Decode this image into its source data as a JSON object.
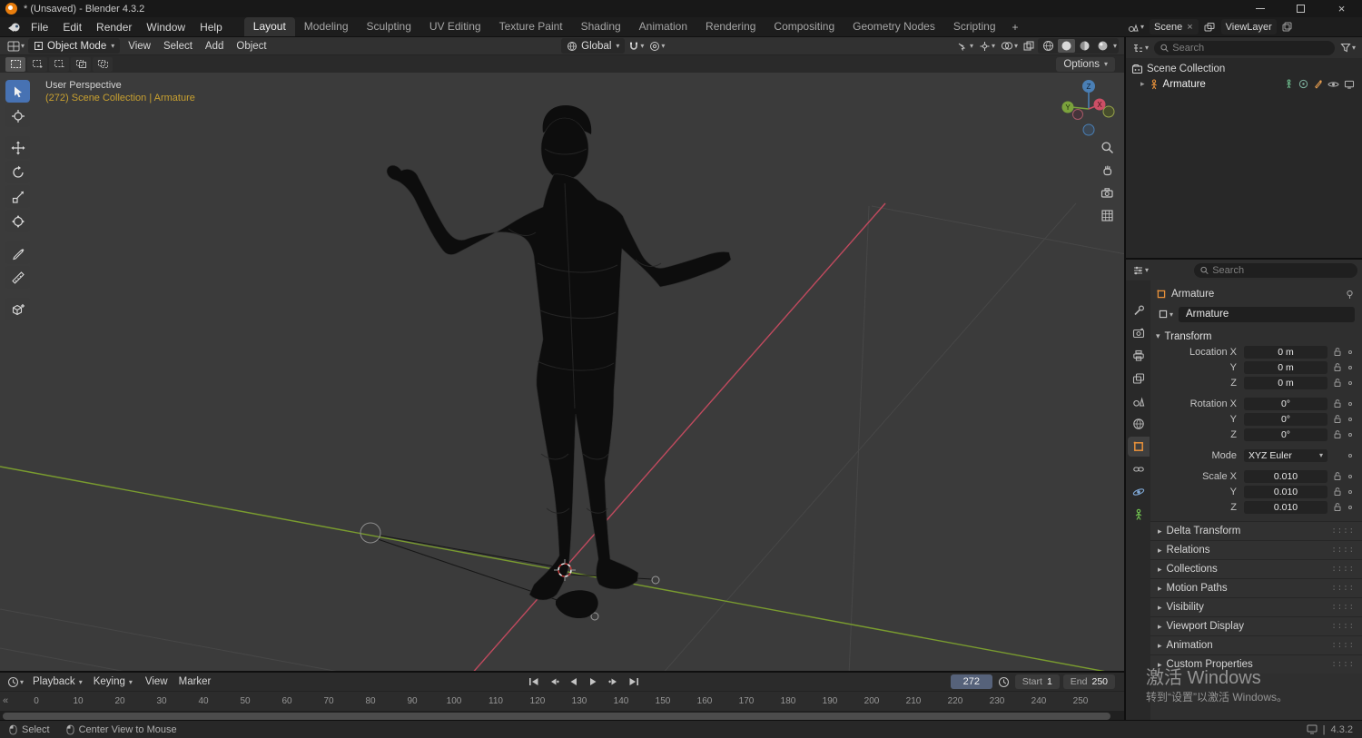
{
  "titlebar": {
    "title": "* (Unsaved) - Blender 4.3.2"
  },
  "topbar": {
    "menus": [
      "File",
      "Edit",
      "Render",
      "Window",
      "Help"
    ],
    "workspaces": [
      {
        "label": "Layout",
        "active": true
      },
      {
        "label": "Modeling"
      },
      {
        "label": "Sculpting"
      },
      {
        "label": "UV Editing"
      },
      {
        "label": "Texture Paint"
      },
      {
        "label": "Shading"
      },
      {
        "label": "Animation"
      },
      {
        "label": "Rendering"
      },
      {
        "label": "Compositing"
      },
      {
        "label": "Geometry Nodes"
      },
      {
        "label": "Scripting"
      }
    ],
    "add_tab": "+",
    "scene_label": "Scene",
    "viewlayer_label": "ViewLayer"
  },
  "viewport": {
    "header": {
      "mode": "Object Mode",
      "menus": [
        "View",
        "Select",
        "Add",
        "Object"
      ],
      "orientation": "Global",
      "options_label": "Options"
    },
    "overlay": {
      "perspective": "User Perspective",
      "collection_info": "(272) Scene Collection | Armature"
    },
    "gizmo_axes": {
      "x": "X",
      "y": "Y",
      "z": "Z"
    },
    "tools": [
      "select-box",
      "cursor",
      "move",
      "rotate",
      "scale",
      "transform",
      "annotate",
      "measure",
      "add-cube"
    ],
    "side_buttons": [
      "zoom",
      "pan",
      "camera-view",
      "toggle-projection"
    ]
  },
  "outliner": {
    "search_placeholder": "Search",
    "rows": {
      "collection": "Scene Collection",
      "object": "Armature"
    }
  },
  "properties": {
    "search_placeholder": "Search",
    "tabs": [
      "tool",
      "render",
      "output",
      "view-layer",
      "scene",
      "world",
      "object",
      "constraints",
      "physics",
      "object-data"
    ],
    "active_tab": "object",
    "breadcrumb": "Armature",
    "name_field": "Armature",
    "transform": {
      "title": "Transform",
      "location_rows": [
        {
          "label": "Location X",
          "value": "0 m"
        },
        {
          "label": "Y",
          "value": "0 m"
        },
        {
          "label": "Z",
          "value": "0 m"
        }
      ],
      "rotation_rows": [
        {
          "label": "Rotation X",
          "value": "0°"
        },
        {
          "label": "Y",
          "value": "0°"
        },
        {
          "label": "Z",
          "value": "0°"
        }
      ],
      "mode_label": "Mode",
      "mode_value": "XYZ Euler",
      "scale_rows": [
        {
          "label": "Scale X",
          "value": "0.010"
        },
        {
          "label": "Y",
          "value": "0.010"
        },
        {
          "label": "Z",
          "value": "0.010"
        }
      ]
    },
    "collapsed_panels": [
      "Delta Transform",
      "Relations",
      "Collections",
      "Motion Paths",
      "Visibility",
      "Viewport Display",
      "Animation",
      "Custom Properties"
    ]
  },
  "timeline": {
    "dropdown_menus": [
      "Playback",
      "Keying"
    ],
    "plain_menus": [
      "View",
      "Marker"
    ],
    "current_frame": "272",
    "start_label": "Start",
    "start_value": "1",
    "end_label": "End",
    "end_value": "250",
    "ticks": [
      "0",
      "10",
      "20",
      "30",
      "40",
      "50",
      "60",
      "70",
      "80",
      "90",
      "100",
      "110",
      "120",
      "130",
      "140",
      "150",
      "160",
      "170",
      "180",
      "190",
      "200",
      "210",
      "220",
      "230",
      "240",
      "250"
    ]
  },
  "statusbar": {
    "hints": [
      "Select",
      "Center View to Mouse"
    ],
    "version": "4.3.2"
  },
  "watermark": {
    "line1": "激活 Windows",
    "line2": "转到“设置”以激活 Windows。"
  },
  "colors": {
    "accent": "#4772b3",
    "axis_x": "#c04a5e",
    "axis_y": "#7a9c2f",
    "axis_z": "#4a7fb5",
    "object_orange": "#e8913a"
  }
}
